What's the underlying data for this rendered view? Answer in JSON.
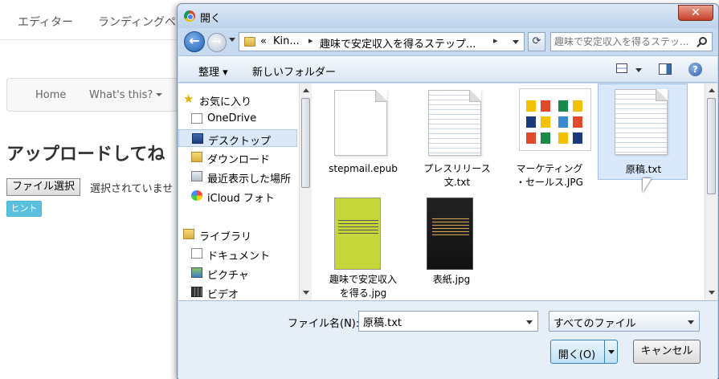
{
  "background": {
    "top_nav": [
      "エディター",
      "ランディングペ"
    ],
    "navbar": {
      "home": "Home",
      "whats_this": "What's this?"
    },
    "heading": "アップロードしてね",
    "file_button": "ファイル選択",
    "no_file_text": "選択されていませ",
    "hint_button": "ヒント"
  },
  "dialog": {
    "title": "開く",
    "close_label": "✕",
    "address": {
      "overflow": "«",
      "crumbs": [
        "Kin...",
        "趣味で安定収入を得るステップ..."
      ]
    },
    "search_placeholder": "趣味で安定収入を得るステッ...",
    "toolbar": {
      "organize": "整理",
      "new_folder": "新しいフォルダー"
    },
    "nav": {
      "favorites": "お気に入り",
      "onedrive": "OneDrive",
      "desktop": "デスクトップ",
      "downloads": "ダウンロード",
      "recent": "最近表示した場所",
      "icloud": "iCloud フォト",
      "libraries": "ライブラリ",
      "documents": "ドキュメント",
      "pictures": "ピクチャ",
      "videos": "ビデオ"
    },
    "files": [
      {
        "name": "stepmail.epub"
      },
      {
        "name": "プレスリリース文.txt",
        "line1": "プレスリリース",
        "line2": "文.txt"
      },
      {
        "name": "マーケティング・セールス.JPG",
        "line1": "マーケティング",
        "line2": "・セールス.JPG"
      },
      {
        "name": "原稿.txt"
      },
      {
        "name": "趣味で安定収入を得る.jpg",
        "line1": "趣味で安定収入",
        "line2": "を得る.jpg"
      },
      {
        "name": "表紙.jpg"
      }
    ],
    "filename_label": "ファイル名(N):",
    "filename_value": "原稿.txt",
    "filetype_value": "すべてのファイル",
    "open_label": "開く(O)",
    "cancel_label": "キャンセル"
  },
  "colors": {
    "dialog_frame": "#c8daf0",
    "selection": "#d9e8fb",
    "close_red": "#c6402a",
    "hint": "#5bc0de"
  }
}
